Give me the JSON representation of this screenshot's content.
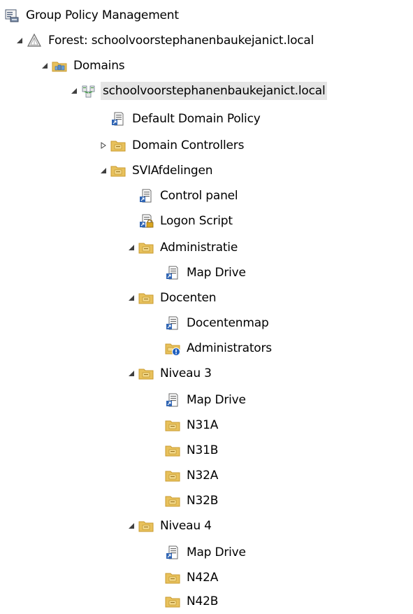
{
  "tree": {
    "root": {
      "label": "Group Policy Management",
      "icon": "gpm-console-icon"
    },
    "forest": {
      "label": "Forest: schoolvoorstephanenbaukejanict.local",
      "icon": "forest-icon",
      "state": "expanded"
    },
    "domains": {
      "label": "Domains",
      "icon": "domains-folder-icon",
      "state": "expanded"
    },
    "domain": {
      "label": "schoolvoorstephanenbaukejanict.local",
      "icon": "domain-icon",
      "state": "expanded"
    },
    "default_policy": {
      "label": "Default Domain Policy",
      "icon": "gpo-link-icon"
    },
    "domain_controllers": {
      "label": "Domain Controllers",
      "icon": "ou-folder-icon",
      "state": "collapsed"
    },
    "svi": {
      "label": "SVIAfdelingen",
      "icon": "ou-folder-icon",
      "state": "expanded"
    },
    "svi_control_panel": {
      "label": "Control panel",
      "icon": "gpo-link-icon"
    },
    "svi_logon_script": {
      "label": "Logon Script",
      "icon": "gpo-link-locked-icon"
    },
    "administratie": {
      "label": "Administratie",
      "icon": "ou-folder-icon",
      "state": "expanded"
    },
    "administratie_map_drive": {
      "label": "Map Drive",
      "icon": "gpo-link-icon"
    },
    "docenten": {
      "label": "Docenten",
      "icon": "ou-folder-icon",
      "state": "expanded"
    },
    "docenten_docentenmap": {
      "label": "Docentenmap",
      "icon": "gpo-link-icon"
    },
    "docenten_administrators": {
      "label": "Administrators",
      "icon": "ou-blocked-inheritance-icon"
    },
    "niveau3": {
      "label": "Niveau 3",
      "icon": "ou-folder-icon",
      "state": "expanded"
    },
    "niveau3_map_drive": {
      "label": "Map Drive",
      "icon": "gpo-link-icon"
    },
    "n31a": {
      "label": "N31A",
      "icon": "ou-folder-icon"
    },
    "n31b": {
      "label": "N31B",
      "icon": "ou-folder-icon"
    },
    "n32a": {
      "label": "N32A",
      "icon": "ou-folder-icon"
    },
    "n32b": {
      "label": "N32B",
      "icon": "ou-folder-icon"
    },
    "niveau4": {
      "label": "Niveau 4",
      "icon": "ou-folder-icon",
      "state": "expanded"
    },
    "niveau4_map_drive": {
      "label": "Map Drive",
      "icon": "gpo-link-icon"
    },
    "n42a": {
      "label": "N42A",
      "icon": "ou-folder-icon"
    },
    "n42b": {
      "label": "N42B",
      "icon": "ou-folder-icon"
    }
  },
  "colors": {
    "selection": "#e5e5e5",
    "folder": "#e8c15c",
    "folder_dark": "#c99a2e",
    "expander": "#404040"
  }
}
